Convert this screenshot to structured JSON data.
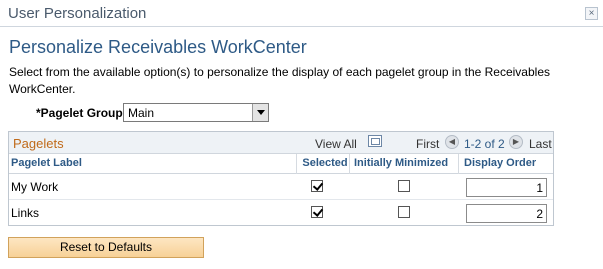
{
  "window": {
    "title": "User Personalization",
    "close_icon": "close-icon",
    "close_glyph": "×"
  },
  "page": {
    "title": "Personalize Receivables WorkCenter",
    "description": "Select from the available option(s) to personalize the display of each pagelet group in the Receivables WorkCenter."
  },
  "pagelet_group": {
    "label": "*Pagelet Group",
    "value": "Main"
  },
  "grid": {
    "title": "Pagelets",
    "view_all": "View All",
    "zoom_icon": "zoom-grid-icon",
    "first": "First",
    "range": "1-2 of 2",
    "last": "Last",
    "prev_glyph": "◀",
    "next_glyph": "▶",
    "columns": [
      "Pagelet Label",
      "Selected",
      "Initially Minimized",
      "Display Order"
    ],
    "rows": [
      {
        "label": "My Work",
        "selected": true,
        "initially_minimized": false,
        "display_order": "1"
      },
      {
        "label": "Links",
        "selected": true,
        "initially_minimized": false,
        "display_order": "2"
      }
    ]
  },
  "actions": {
    "reset": "Reset to Defaults"
  },
  "colors": {
    "title_blue": "#2e5a86",
    "grid_title_orange": "#c06a1a",
    "button_fill": "#f7d197"
  }
}
